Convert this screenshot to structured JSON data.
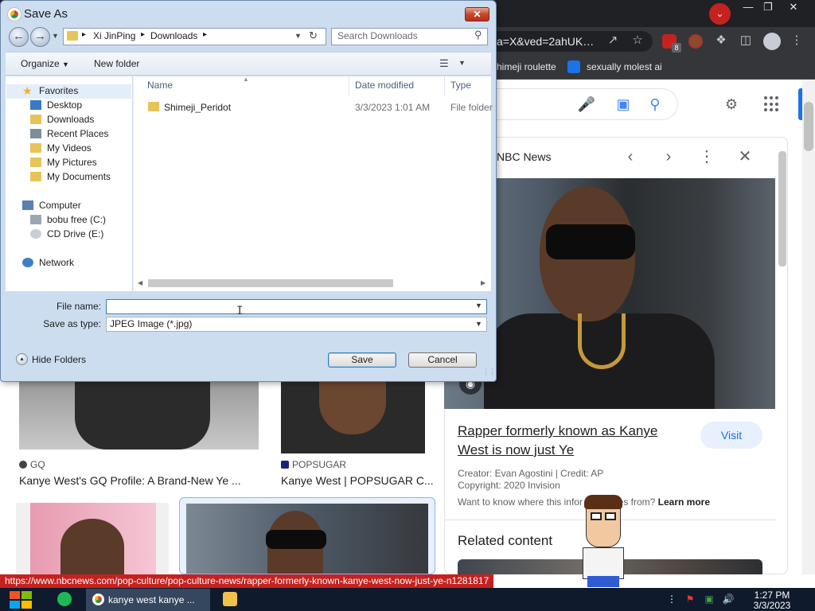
{
  "browser": {
    "omnibox_text": "a=X&ved=2ahUK…",
    "bookmarks": [
      "himeji roulette",
      "sexually molest ai"
    ],
    "extension_badge": "8",
    "window_controls": [
      "—",
      "❐",
      "✕"
    ]
  },
  "side_panel": {
    "source": "NBC News",
    "title": "Rapper formerly known as Kanye West is now just Ye",
    "visit_label": "Visit",
    "creator": "Creator: Evan Agostini | Credit: AP",
    "copyright": "Copyright: 2020 Invision",
    "know_prefix": "Want to know where this infor",
    "know_suffix": "omes from?",
    "learn_more": "Learn more",
    "related_heading": "Related content"
  },
  "results": [
    {
      "source": "GQ",
      "title": "Kanye West's GQ Profile: A Brand-New Ye ..."
    },
    {
      "source": "POPSUGAR",
      "title": "Kanye West | POPSUGAR C..."
    }
  ],
  "status_url": "https://www.nbcnews.com/pop-culture/pop-culture-news/rapper-formerly-known-kanye-west-now-just-ye-n1281817",
  "taskbar": {
    "app_label": "kanye west kanye ...",
    "time": "1:27 PM",
    "date": "3/3/2023"
  },
  "dialog": {
    "title": "Save As",
    "breadcrumb": [
      "Xi JinPing",
      "Downloads"
    ],
    "search_placeholder": "Search Downloads",
    "toolbar": {
      "organize": "Organize",
      "new_folder": "New folder"
    },
    "nav": {
      "favorites": "Favorites",
      "desktop": "Desktop",
      "downloads": "Downloads",
      "recent_places": "Recent Places",
      "my_videos": "My Videos",
      "my_pictures": "My Pictures",
      "my_documents": "My Documents",
      "computer": "Computer",
      "drive_c": "bobu free (C:)",
      "drive_e": "CD Drive (E:)",
      "network": "Network"
    },
    "columns": {
      "name": "Name",
      "date_modified": "Date modified",
      "type": "Type"
    },
    "files": [
      {
        "name": "Shimeji_Peridot",
        "date": "3/3/2023 1:01 AM",
        "type": "File folder"
      }
    ],
    "file_name_label": "File name:",
    "file_name_value": "",
    "save_type_label": "Save as type:",
    "save_type_value": "JPEG Image (*.jpg)",
    "hide_folders": "Hide Folders",
    "save_label": "Save",
    "cancel_label": "Cancel"
  }
}
